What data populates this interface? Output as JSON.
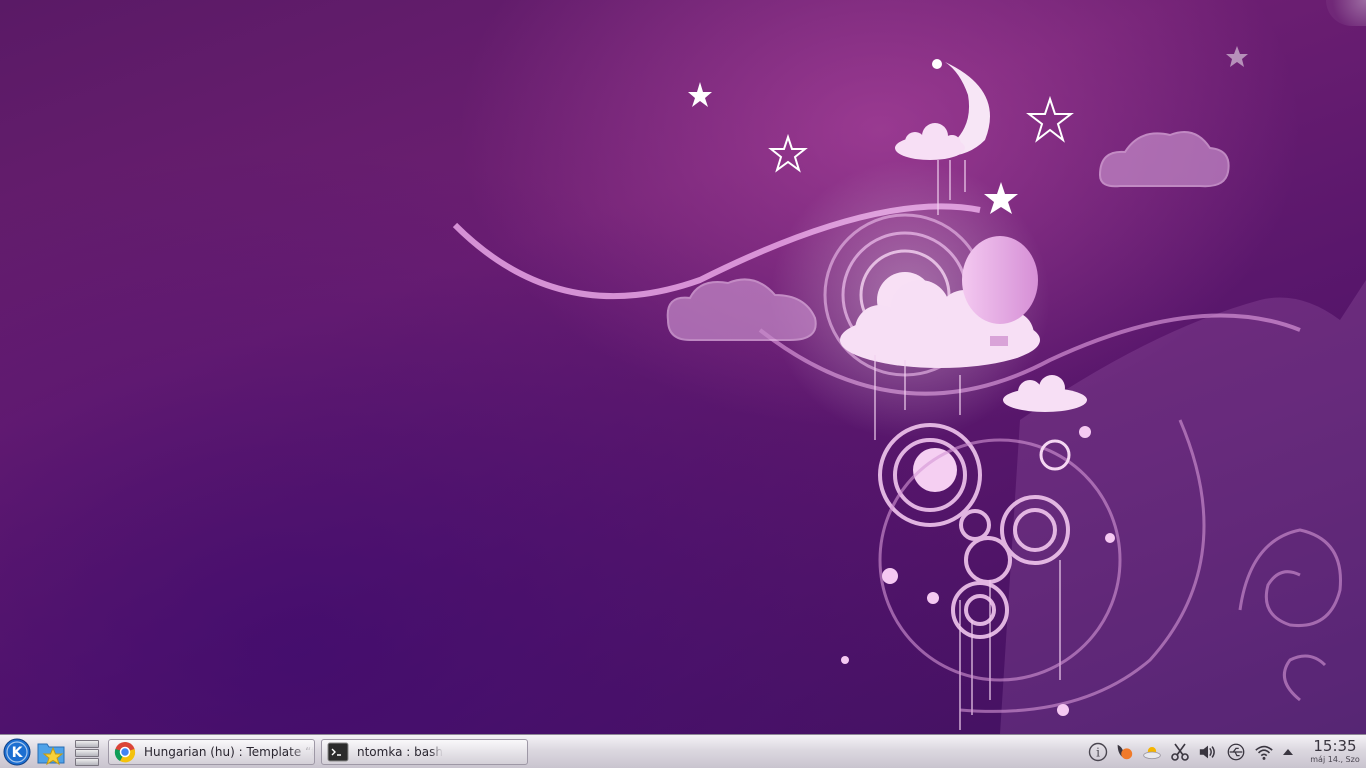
{
  "taskbar": {
    "tasks": [
      {
        "label": "Hungarian (hu) : Template “translation”",
        "icon": "chrome-icon"
      },
      {
        "label": "ntomka : bash",
        "icon": "terminal-icon"
      }
    ],
    "clock": {
      "time": "15:35",
      "date": "máj 14., Szo"
    }
  },
  "colors": {
    "taskbar_bg": "#dcd8e0",
    "wallpaper_base": "#5a1a66",
    "kde_blue": "#1d6fd1"
  },
  "icons": {
    "launcher": "kde-menu-icon",
    "folder": "folder-favorites-icon",
    "pager": "desktop-pager-icon",
    "tray": [
      "info-icon",
      "klipper-icon",
      "weather-icon",
      "scissors-icon",
      "volume-icon",
      "usb-icon",
      "wifi-icon",
      "tray-expand-icon"
    ]
  }
}
